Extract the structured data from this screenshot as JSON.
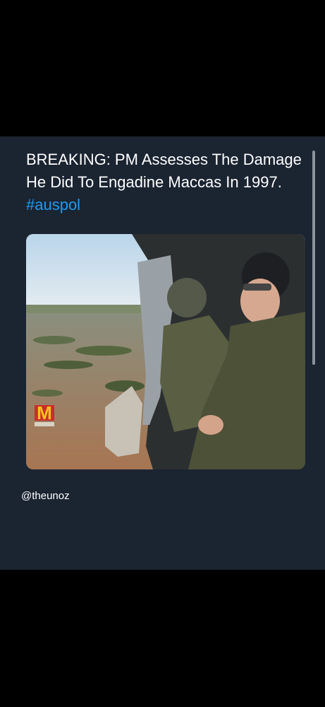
{
  "tweet": {
    "text_main": "BREAKING: PM Assesses The Damage He Did To Engadine Maccas In 1997.",
    "hashtag": "#auspol",
    "handle": "@theunoz"
  },
  "colors": {
    "background": "#000000",
    "card": "#1b2431",
    "text": "#ffffff",
    "link": "#1d9bf0"
  }
}
